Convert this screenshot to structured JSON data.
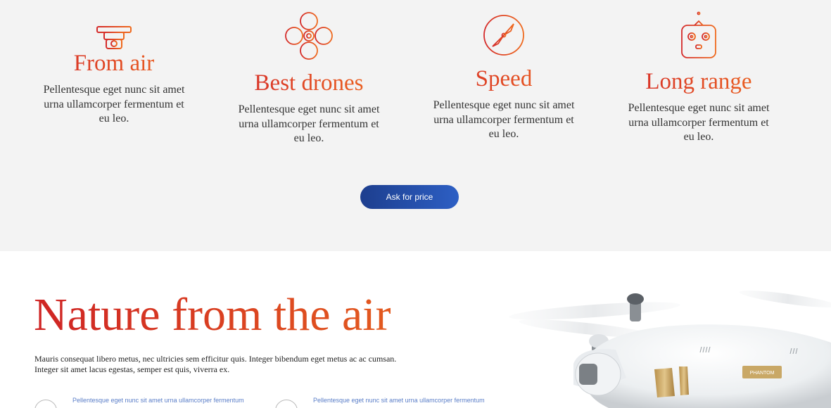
{
  "features": [
    {
      "icon": "drone-camera-icon",
      "title": "From air",
      "text": "Pellentesque eget nunc sit amet urna ullamcorper fermentum et eu leo."
    },
    {
      "icon": "quadcopter-icon",
      "title": "Best drones",
      "text": "Pellentesque eget nunc sit amet urna ullamcorper fermentum et eu leo."
    },
    {
      "icon": "propeller-icon",
      "title": "Speed",
      "text": "Pellentesque eget nunc sit amet urna ullamcorper fermentum et eu leo."
    },
    {
      "icon": "remote-controller-icon",
      "title": "Long range",
      "text": "Pellentesque eget nunc sit amet urna ullamcorper fermentum et eu leo."
    }
  ],
  "cta": {
    "label": "Ask for price"
  },
  "nature": {
    "title": "Nature from the air",
    "description": "Mauris consequat libero metus, nec ultricies sem efficitur quis. Integer bibendum eget metus ac ac cumsan. Integer sit amet lacus egestas, semper est quis, viverra ex.",
    "items": [
      {
        "text": "Pellentesque eget nunc sit amet urna ullamcorper fermentum"
      },
      {
        "text": "Pellentesque eget nunc sit amet urna ullamcorper fermentum"
      }
    ],
    "drone_label": "PHANTOM"
  },
  "colors": {
    "accent_red": "#d42a2a",
    "accent_orange": "#ef6a1e",
    "button_blue": "#1d3e8e",
    "section_bg": "#f3f3f3"
  }
}
